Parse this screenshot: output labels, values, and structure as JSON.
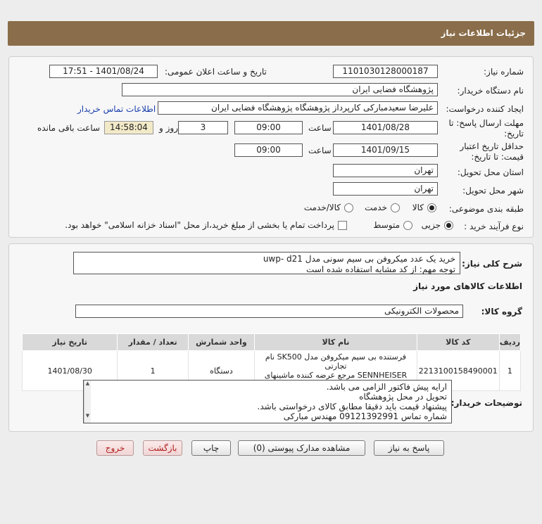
{
  "header": {
    "title": "جزئیات اطلاعات نیاز"
  },
  "form": {
    "need_number": {
      "label": "شماره نیاز:",
      "value": "1101030128000187"
    },
    "announce_datetime": {
      "label": "تاریخ و ساعت اعلان عمومی:",
      "value": "1401/08/24 - 17:51"
    },
    "buyer_org": {
      "label": "نام دستگاه خریدار:",
      "value": "پژوهشگاه فضایی ایران"
    },
    "requester": {
      "label": "ایجاد کننده درخواست:",
      "value": "علیرضا سعیدمبارکی کارپرداز پژوهشگاه  پژوهشگاه فضایی ایران",
      "contact_link": "اطلاعات تماس خریدار"
    },
    "reply_deadline": {
      "label_line1": "مهلت ارسال پاسخ: تا",
      "label_line2": "تاریخ:",
      "date": "1401/08/28",
      "time_label": "ساعت",
      "time": "09:00",
      "days": "3",
      "days_label": "روز و",
      "remaining": "14:58:04",
      "remaining_label": "ساعت باقی مانده"
    },
    "price_validity": {
      "label_line1": "حداقل تاریخ اعتبار",
      "label_line2": "قیمت: تا تاریخ:",
      "date": "1401/09/15",
      "time_label": "ساعت",
      "time": "09:00"
    },
    "delivery_province": {
      "label": "استان محل تحویل:",
      "value": "تهران"
    },
    "delivery_city": {
      "label": "شهر محل تحویل:",
      "value": "تهران"
    },
    "category": {
      "label": "طبقه بندی موضوعی:",
      "options": [
        "کالا",
        "خدمت",
        "کالا/خدمت"
      ],
      "selected": "کالا"
    },
    "process_type": {
      "label": "نوع فرآیند خرید :",
      "options": [
        "جزیی",
        "متوسط"
      ],
      "selected": "جزیی",
      "payment_note": "پرداخت تمام یا بخشی از مبلغ خرید،از محل \"اسناد خزانه اسلامی\" خواهد بود."
    }
  },
  "description": {
    "label": "شرح کلی نیاز:",
    "line1": "خرید یک عدد میکروفن بی سیم سونی مدل uwp- d21",
    "line2": "توجه مهم: از کد مشابه استفاده شده است"
  },
  "goods_section": {
    "title": "اطلاعات کالاهای مورد نیاز",
    "group_label": "گروه کالا:",
    "group_value": "محصولات الکترونیکی",
    "table": {
      "headers": [
        "ردیف",
        "کد کالا",
        "نام کالا",
        "واحد شمارش",
        "تعداد / مقدار",
        "تاریخ نیاز"
      ],
      "rows": [
        {
          "row": "1",
          "code": "2213100158490001",
          "name_line1": "فرستنده بی سیم میکروفن مدل SK500 نام تجارتی",
          "name_line2": "SENNHEISER مرجع عرضه کننده ماشینهای اداری بعثت",
          "unit": "دستگاه",
          "qty": "1",
          "date": "1401/08/30"
        }
      ]
    }
  },
  "buyer_notes": {
    "label": "توضیحات خریدار:",
    "lines": [
      "ارایه پیش فاکتور الزامی می باشد.",
      "تحویل در محل پژوهشگاه",
      "پیشنهاد قیمت باید دقیقا مطابق کالای درخواستی باشد.",
      "شماره تماس 09121392991 مهندس مبارکی"
    ]
  },
  "buttons": {
    "reply": "پاسخ به نیاز",
    "attachments": "مشاهده مدارک پیوستی (0)",
    "print": "چاپ",
    "back": "بازگشت",
    "exit": "خروج"
  },
  "colors": {
    "header": "#8a6d4a",
    "link": "#1a3fae",
    "remaining_bg": "#f2e9c8"
  }
}
